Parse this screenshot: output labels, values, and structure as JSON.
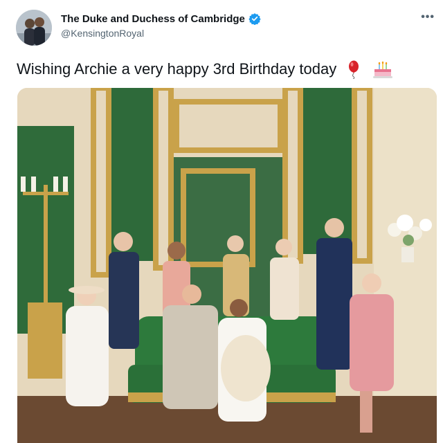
{
  "tweet": {
    "display_name": "The Duke and Duchess of Cambridge",
    "handle": "@KensingtonRoyal",
    "text": "Wishing Archie a very happy 3rd Birthday today",
    "emojis": [
      "balloon-icon",
      "birthday-cake-icon"
    ]
  },
  "icons": {
    "verified": "verified-badge-icon",
    "more": "more-options-icon"
  },
  "colors": {
    "verified": "#1d9bf0",
    "wall_green": "#2f6b3a",
    "gold": "#c9a24a"
  }
}
